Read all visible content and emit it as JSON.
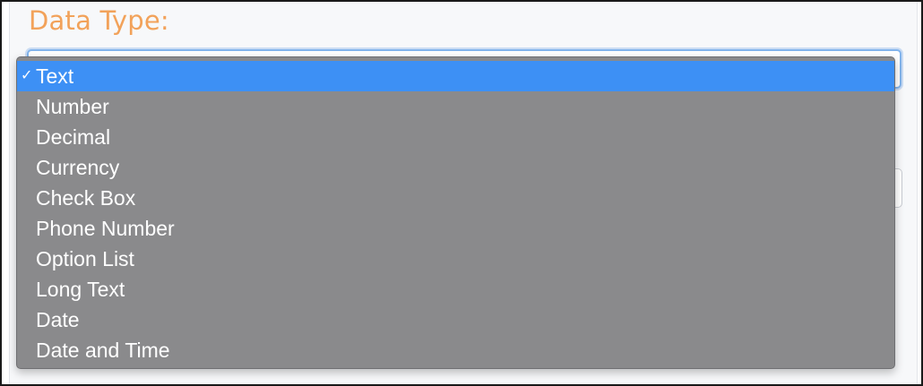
{
  "field": {
    "label": "Data Type:"
  },
  "select": {
    "selected_value": "Text"
  },
  "dropdown": {
    "options": [
      {
        "label": "Text",
        "selected": true
      },
      {
        "label": "Number",
        "selected": false
      },
      {
        "label": "Decimal",
        "selected": false
      },
      {
        "label": "Currency",
        "selected": false
      },
      {
        "label": "Check Box",
        "selected": false
      },
      {
        "label": "Phone Number",
        "selected": false
      },
      {
        "label": "Option List",
        "selected": false
      },
      {
        "label": "Long Text",
        "selected": false
      },
      {
        "label": "Date",
        "selected": false
      },
      {
        "label": "Date and Time",
        "selected": false
      }
    ],
    "check_glyph": "✓"
  },
  "colors": {
    "label": "#f2a25a",
    "highlight": "#3d90f5",
    "menu_bg": "#8a8a8c",
    "focus_border": "#82b4ec"
  }
}
